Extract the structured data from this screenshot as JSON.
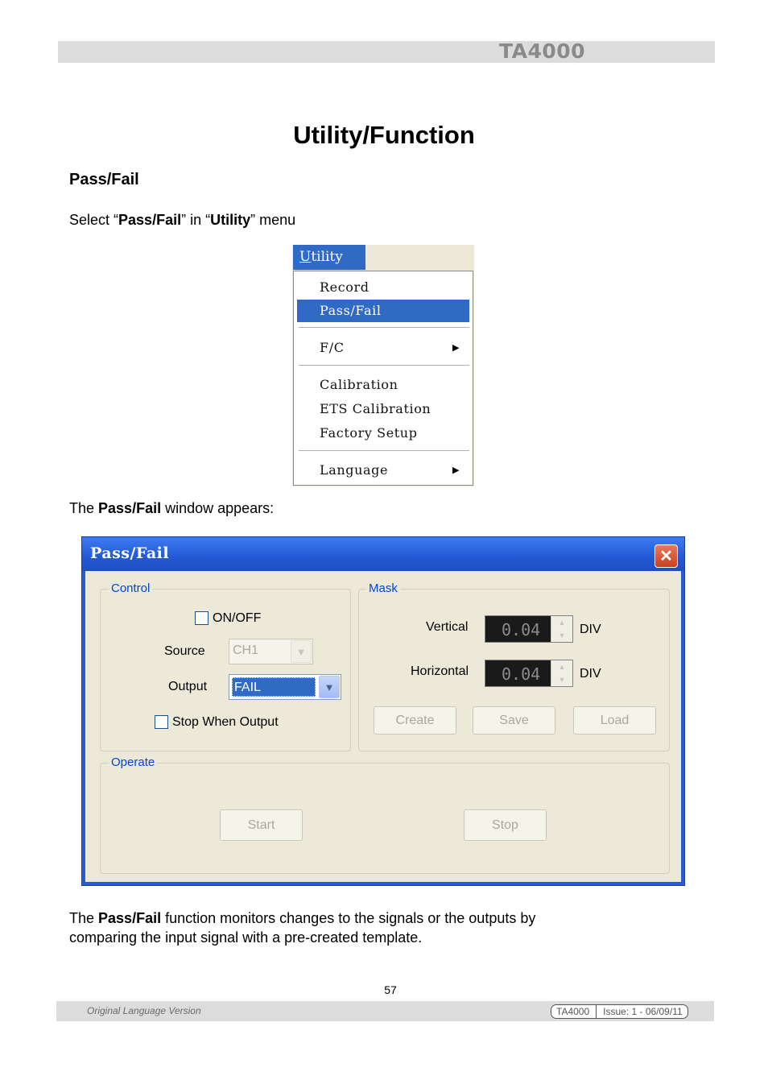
{
  "header": {
    "product": "TA4000"
  },
  "page_title": "Utility/Function",
  "section_heading": "Pass/Fail",
  "intro": {
    "prefix": "Select “",
    "bold1": "Pass/Fail",
    "middle": "” in “",
    "bold2": "Utility",
    "suffix": "” menu"
  },
  "utility_menu": {
    "title": "Utility",
    "title_mnemonic": "U",
    "title_rest": "tility",
    "items": [
      {
        "label": "Record",
        "selected": false,
        "submenu": false
      },
      {
        "label": "Pass/Fail",
        "selected": true,
        "submenu": false
      },
      {
        "label": "F/C",
        "selected": false,
        "submenu": true
      },
      {
        "label": "Calibration",
        "selected": false,
        "submenu": false
      },
      {
        "label": "ETS Calibration",
        "selected": false,
        "submenu": false
      },
      {
        "label": "Factory Setup",
        "selected": false,
        "submenu": false
      },
      {
        "label": "Language",
        "selected": false,
        "submenu": true
      }
    ],
    "submenu_arrow": "▶"
  },
  "window_intro": {
    "prefix": "The ",
    "bold": "Pass/Fail",
    "suffix": " window appears:"
  },
  "passfail_window": {
    "title": "Pass/Fail",
    "close_glyph": "✕",
    "control": {
      "label": "Control",
      "onoff_label": "ON/OFF",
      "onoff_checked": false,
      "source_label": "Source",
      "source_value": "CH1",
      "output_label": "Output",
      "output_value": "FAIL",
      "stop_when_output_label": "Stop When Output",
      "stop_when_output_checked": false
    },
    "mask": {
      "label": "Mask",
      "vertical_label": "Vertical",
      "vertical_value": "0.04",
      "horizontal_label": "Horizontal",
      "horizontal_value": "0.04",
      "unit": "DIV",
      "create_label": "Create",
      "save_label": "Save",
      "load_label": "Load"
    },
    "operate": {
      "label": "Operate",
      "start_label": "Start",
      "stop_label": "Stop"
    }
  },
  "description": {
    "prefix": "The ",
    "bold": "Pass/Fail",
    "line1_rest": " function monitors changes to the signals or the outputs by",
    "line2": "comparing the input signal with a pre-created template."
  },
  "page_number": "57",
  "footer": {
    "left": "Original Language Version",
    "product": "TA4000",
    "issue": "Issue: 1 - 06/09/11"
  }
}
